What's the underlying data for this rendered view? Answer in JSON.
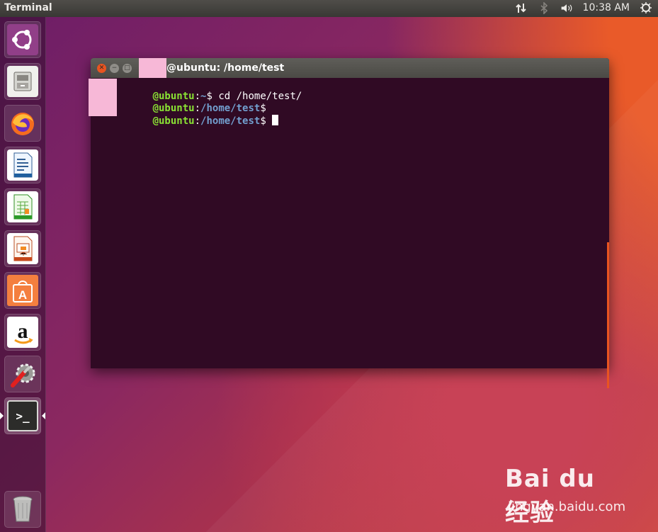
{
  "topbar": {
    "app_name": "Terminal",
    "clock": "10:38 AM",
    "tray_icons": [
      "network-icon",
      "bluetooth-icon",
      "volume-icon",
      "power-icon"
    ]
  },
  "launcher": {
    "items": [
      {
        "name": "ubuntu-dash",
        "icon": "ubuntu-logo-icon"
      },
      {
        "name": "files",
        "icon": "file-cabinet-icon"
      },
      {
        "name": "firefox",
        "icon": "firefox-icon"
      },
      {
        "name": "writer",
        "icon": "writer-document-icon"
      },
      {
        "name": "calc",
        "icon": "calc-spreadsheet-icon"
      },
      {
        "name": "impress",
        "icon": "impress-presentation-icon"
      },
      {
        "name": "software",
        "icon": "software-center-bag-icon"
      },
      {
        "name": "amazon",
        "icon": "amazon-icon"
      },
      {
        "name": "settings",
        "icon": "settings-wrench-gear-icon"
      },
      {
        "name": "terminal",
        "icon": "terminal-icon"
      },
      {
        "name": "trash",
        "icon": "trash-icon"
      }
    ],
    "terminal_prompt_glyph": ">_",
    "amazon_letter": "a",
    "software_letter": "A"
  },
  "terminal": {
    "title": "@ubuntu: /home/test",
    "buttons": {
      "close": "✕",
      "minimize": "−",
      "maximize": "□"
    },
    "lines": [
      {
        "host": "@ubuntu",
        "sep": ":",
        "path": "~",
        "prompt": "$ ",
        "command": "cd /home/test/"
      },
      {
        "host": "@ubuntu",
        "sep": ":",
        "path": "/home/test",
        "prompt": "$",
        "command": ""
      },
      {
        "host": "@ubuntu",
        "sep": ":",
        "path": "/home/test",
        "prompt": "$",
        "command": ""
      }
    ]
  },
  "watermark": {
    "brand": "Bai du 经验",
    "url": "jingyan.baidu.com"
  },
  "colors": {
    "terminal_bg": "#300a24",
    "host_green": "#8ae234",
    "path_blue": "#729fcf",
    "ubuntu_orange": "#e95420",
    "mask_pink": "#f7b8d7"
  }
}
